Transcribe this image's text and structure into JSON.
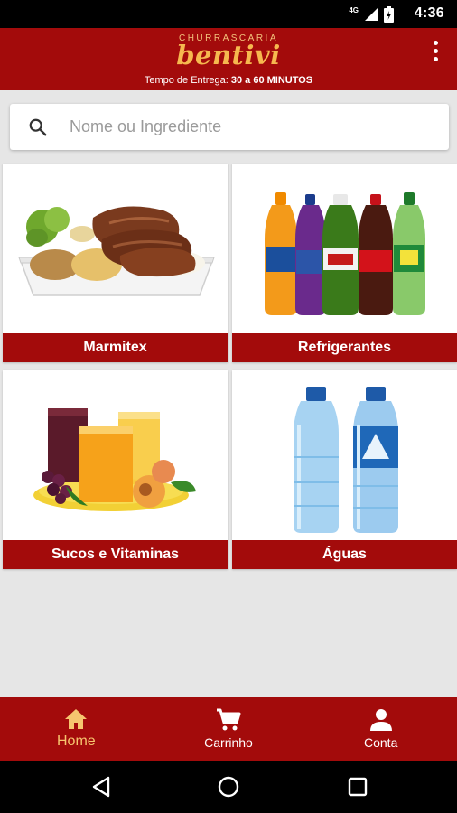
{
  "status_bar": {
    "network_label": "4G",
    "time": "4:36"
  },
  "header": {
    "brand_top": "CHURRASCARIA",
    "brand_name": "bentivi",
    "delivery_label": "Tempo de Entrega:",
    "delivery_value": "30 a 60 MINUTOS"
  },
  "search": {
    "placeholder": "Nome ou Ingrediente",
    "value": ""
  },
  "categories": [
    {
      "label": "Marmitex",
      "image": "marmitex-food-tray"
    },
    {
      "label": "Refrigerantes",
      "image": "soda-bottles"
    },
    {
      "label": "Sucos e Vitaminas",
      "image": "juice-glasses"
    },
    {
      "label": "Águas",
      "image": "water-bottles"
    }
  ],
  "bottom_nav": {
    "items": [
      {
        "label": "Home",
        "icon": "home-icon",
        "active": true
      },
      {
        "label": "Carrinho",
        "icon": "cart-icon",
        "active": false
      },
      {
        "label": "Conta",
        "icon": "person-icon",
        "active": false
      }
    ]
  },
  "colors": {
    "brand_red": "#a30b0b",
    "brand_gold": "#f6b84f",
    "active_nav": "#f6c56f",
    "background": "#e6e6e6"
  }
}
